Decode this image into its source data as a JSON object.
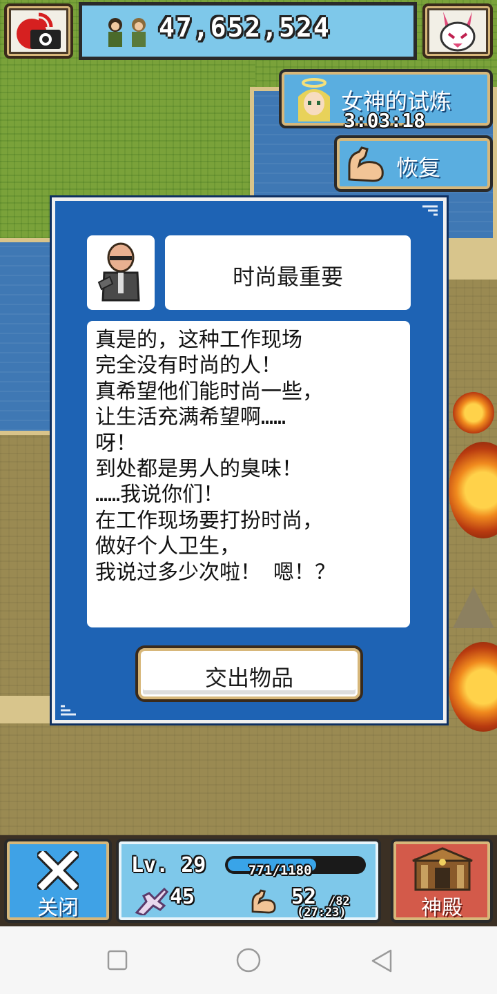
{
  "top_bar": {
    "fame_value": "47,652,524",
    "camera_icon": "camera-icon",
    "avatar_icon": "bunny-mascot-icon"
  },
  "trial": {
    "label": "女神的试炼",
    "timer": "3:03:18",
    "icon": "goddess-portrait-icon"
  },
  "recover": {
    "label": "恢复",
    "icon": "muscle-arm-icon"
  },
  "dialog": {
    "npc_name": "时尚最重要",
    "npc_icon": "bald-worker-portrait-icon",
    "message": "真是的，这种工作现场\n完全没有时尚的人！\n真希望他们能时尚一些，\n让生活充满希望啊……\n呀！\n到处都是男人的臭味！\n……我说你们！\n在工作现场要打扮时尚，\n做好个人卫生，\n我说过多少次啦！ 嗯！？",
    "submit_label": "交出物品"
  },
  "bottom_bar": {
    "close_label": "关闭",
    "level": "Lv. 29",
    "xp_text": "771/1180",
    "xp_fraction": 0.653,
    "attack": "45",
    "stamina_current": "52",
    "stamina_max": "/82",
    "stamina_regen": "(27:23)",
    "temple_label": "神殿"
  },
  "colors": {
    "dialog_blue": "#1e63b4",
    "panel_sky": "#7ec8ea",
    "temple_red": "#d35a4a"
  }
}
